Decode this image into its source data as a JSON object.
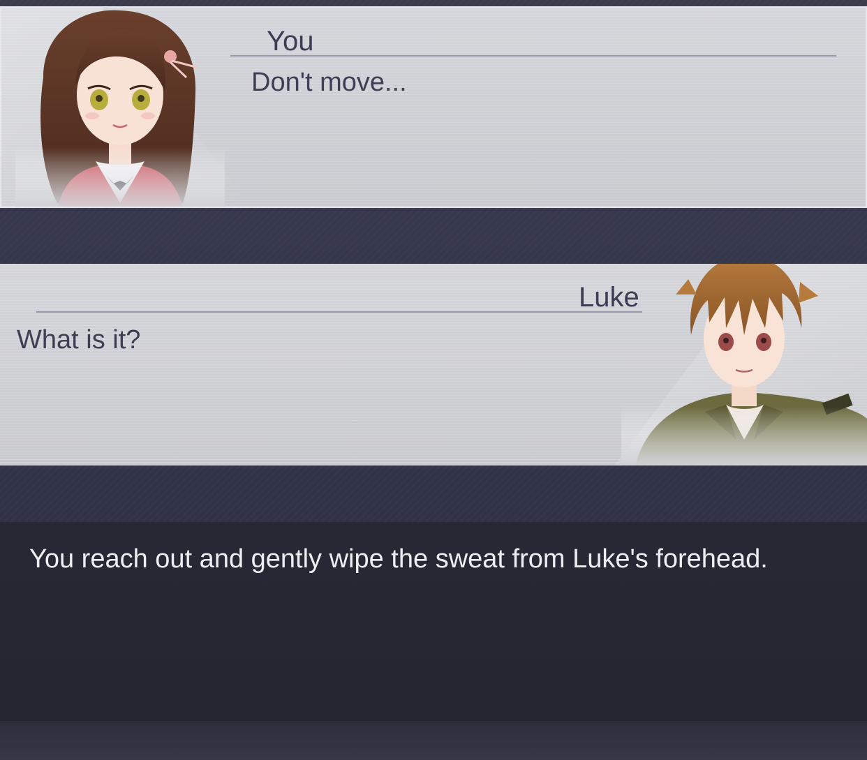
{
  "dialogue": [
    {
      "speaker": "You",
      "line": "Don't move...",
      "portrait_icon": "female-character-portrait"
    },
    {
      "speaker": "Luke",
      "line": "What is it?",
      "portrait_icon": "male-character-portrait"
    }
  ],
  "narration": {
    "text": "You reach out and gently wipe the sweat from Luke's forehead."
  },
  "colors": {
    "bubble": "#cfd0d5",
    "name_text": "#3b3d55",
    "narration_bg": "#252732",
    "narration_text": "#eeeef2"
  }
}
